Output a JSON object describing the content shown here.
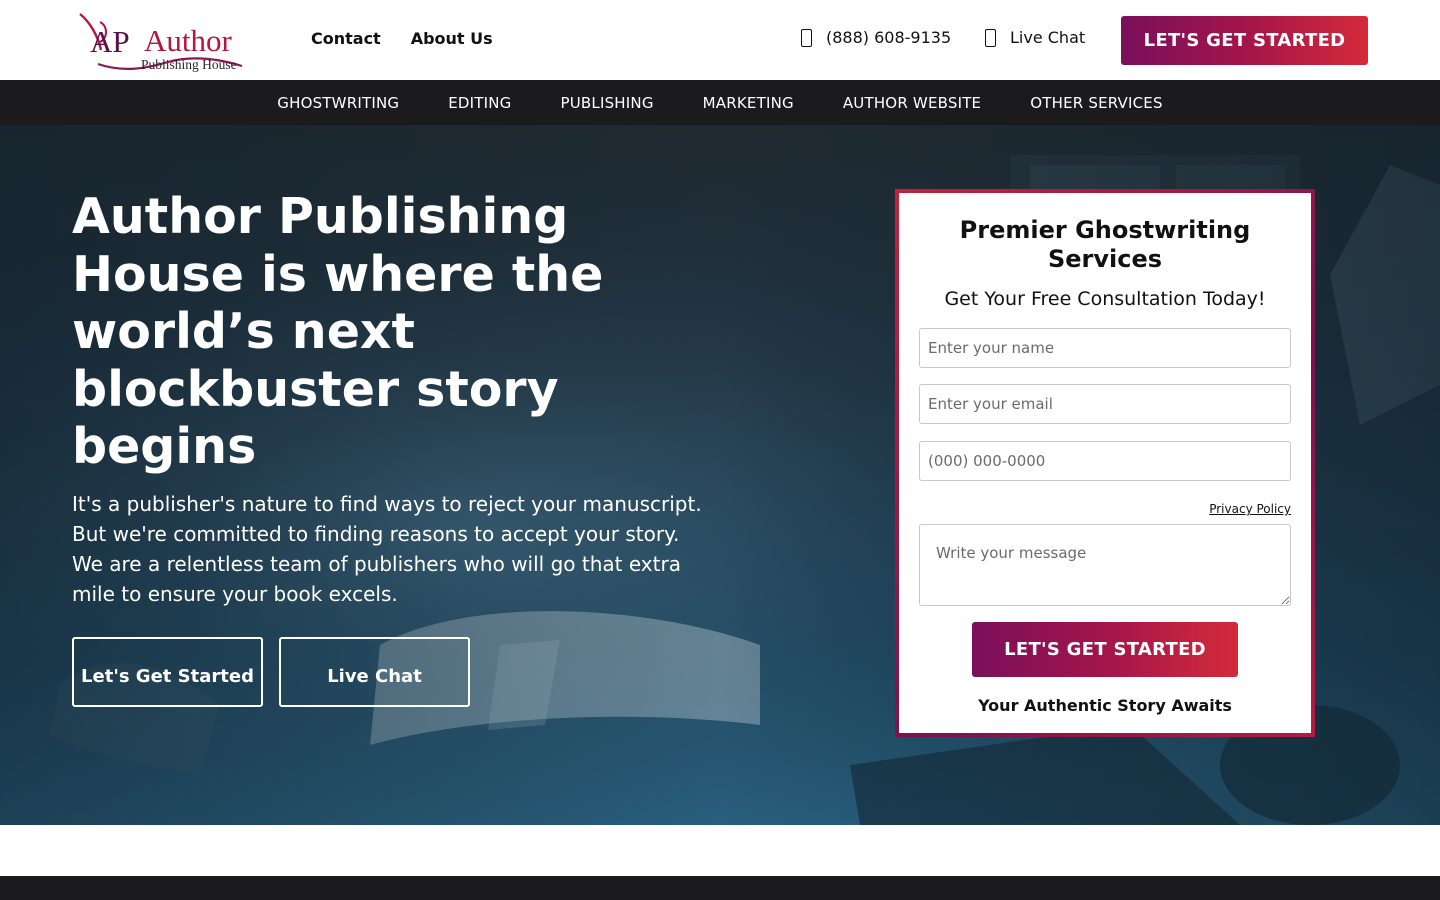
{
  "brand": {
    "logo_mark": "AP",
    "logo_name": "Author",
    "logo_sub": "Publishing House"
  },
  "header": {
    "links": [
      "Contact",
      "About Us"
    ],
    "phone": "(888) 608-9135",
    "chat": "Live Chat",
    "cta": "LET'S GET STARTED"
  },
  "nav": {
    "items": [
      "GHOSTWRITING",
      "EDITING",
      "PUBLISHING",
      "MARKETING",
      "AUTHOR WEBSITE",
      "OTHER SERVICES"
    ]
  },
  "hero": {
    "title": "Author Publishing House is where the world’s next blockbuster story begins",
    "text": "It's a publisher's nature to find ways to reject your manuscript. But we're committed to finding reasons to accept your story. We are a relentless team of publishers who will go that extra mile to ensure your book excels.",
    "primary_button": "Let's Get Started",
    "secondary_button": "Live Chat"
  },
  "form": {
    "title": "Premier Ghostwriting Services",
    "subtitle": "Get Your Free Consultation Today!",
    "name_placeholder": "Enter your name",
    "email_placeholder": "Enter your email",
    "phone_placeholder": "(000) 000-0000",
    "privacy": "Privacy Policy",
    "message_placeholder": "Write your message",
    "submit": "LET'S GET STARTED",
    "tagline": "Your Authentic Story Awaits"
  },
  "colors": {
    "brand_primary": "#7a0f5c",
    "brand_accent": "#d42a3a",
    "nav_bg": "#1b1b1d",
    "hero_tint": "#1f4b66"
  },
  "icons": {
    "phone": "phone-icon",
    "chat": "chat-icon"
  }
}
